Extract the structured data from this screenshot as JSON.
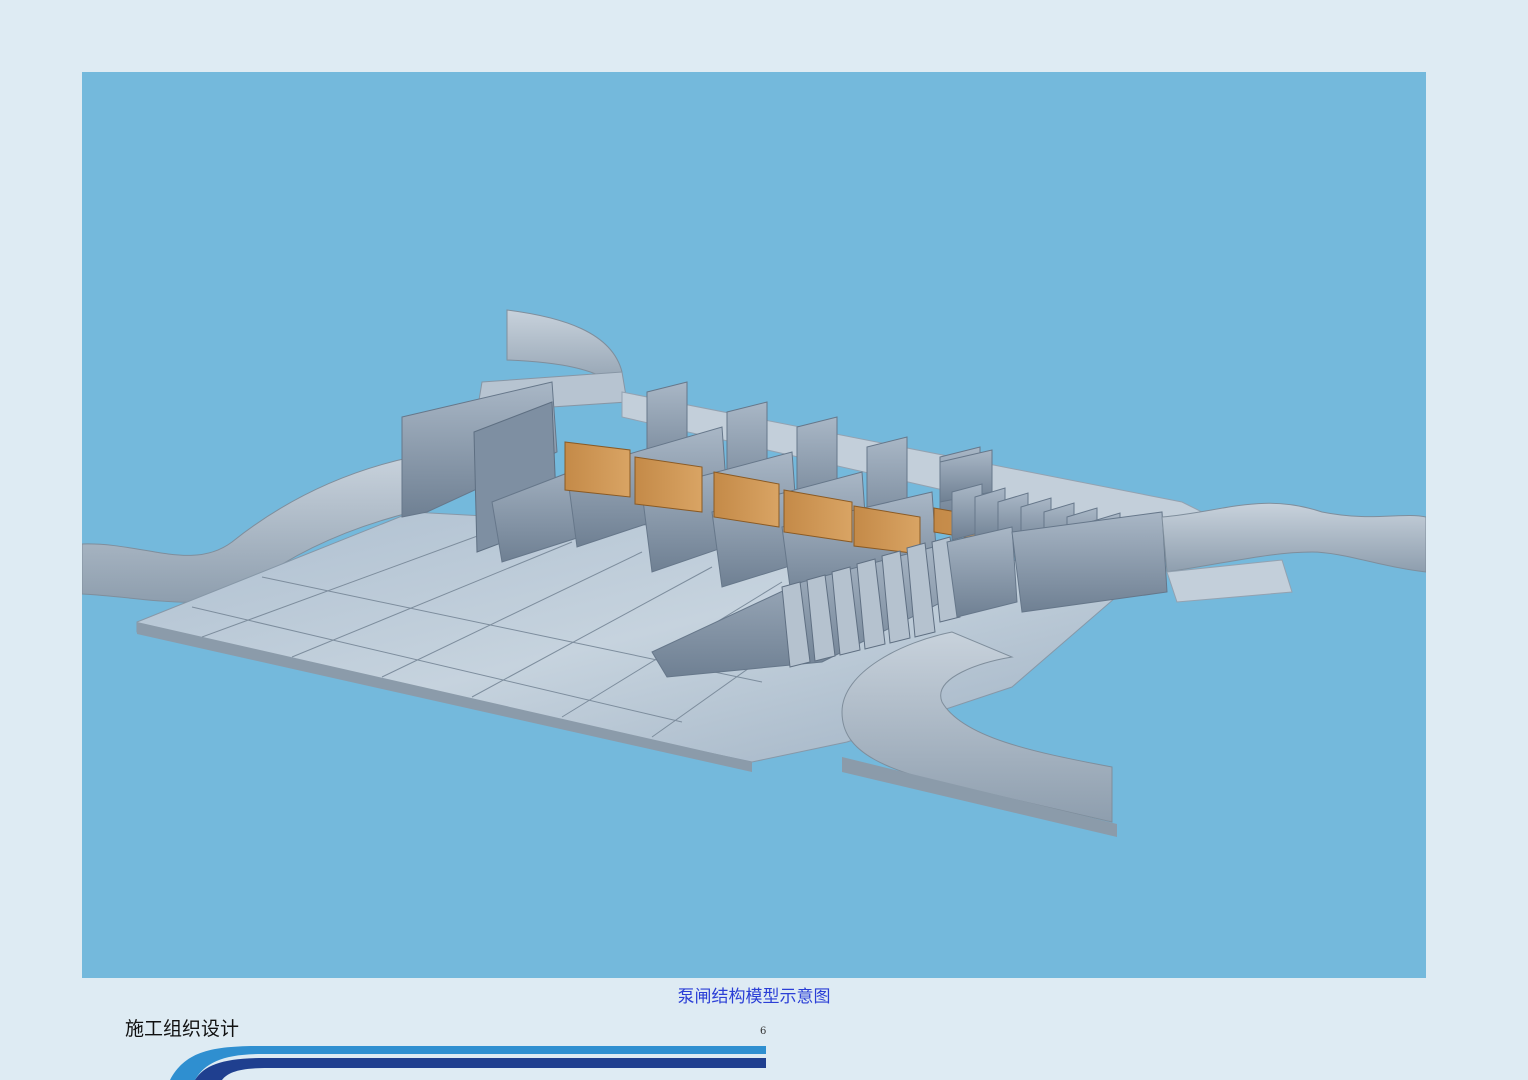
{
  "caption": "泵闸结构模型示意图",
  "footer": {
    "doc_title": "施工组织设计",
    "page_number": "6"
  },
  "colors": {
    "figure_background": "#74b9dc",
    "page_background": "#deebf3",
    "caption_color": "#2b3fd6",
    "band_dark": "#1f3f8f",
    "band_light": "#2f8fd0"
  }
}
